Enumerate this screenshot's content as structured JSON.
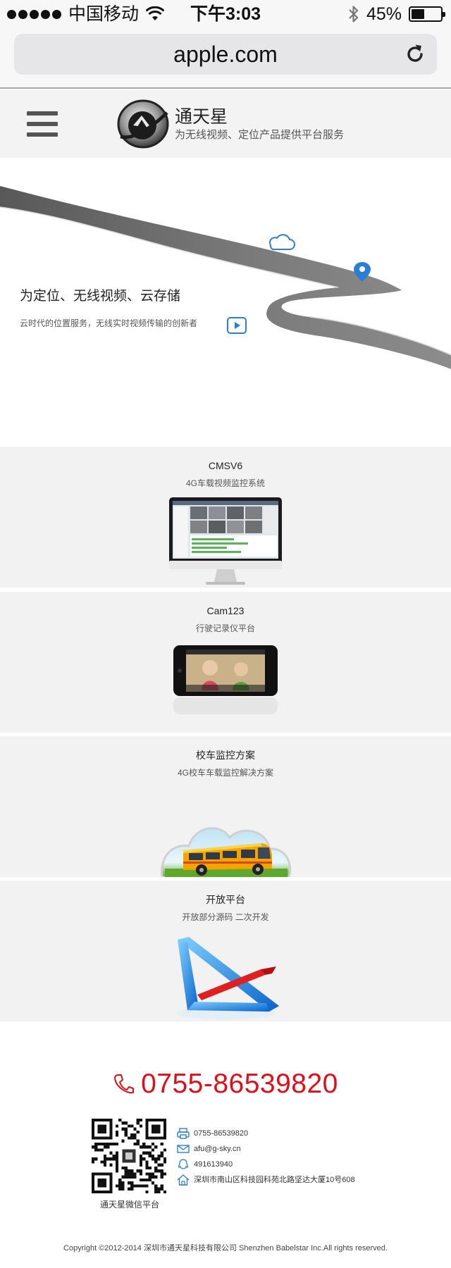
{
  "status_bar": {
    "carrier": "中国移动",
    "time": "下午3:03",
    "battery_percent_label": "45%",
    "battery_level": 0.45
  },
  "browser": {
    "url": "apple.com"
  },
  "header": {
    "brand_name": "通天星",
    "slogan": "为无线视频、定位产品提供平台服务"
  },
  "hero": {
    "title": "为定位、无线视频、云存储",
    "subtitle": "云时代的位置服务，无线实时视频传输的创新者"
  },
  "products": [
    {
      "title": "CMSV6",
      "subtitle": "4G车载视频监控系统"
    },
    {
      "title": "Cam123",
      "subtitle": "行驶记录仪平台"
    },
    {
      "title": "校车监控方案",
      "subtitle": "4G校车车载监控解决方案"
    },
    {
      "title": "开放平台",
      "subtitle": "开放部分源码  二次开发"
    }
  ],
  "footer": {
    "phone": "0755-86539820",
    "qr_caption": "通天星微信平台",
    "contacts": [
      {
        "icon": "fax-icon",
        "text": "0755-86539820"
      },
      {
        "icon": "email-icon",
        "text": "afu@g-sky.cn"
      },
      {
        "icon": "qq-icon",
        "text": "491613940"
      },
      {
        "icon": "home-icon",
        "text": "深圳市南山区科技园科苑北路坚达大厦10号608"
      }
    ],
    "copyright": "Copyright ©2012-2014 深圳市通天星科技有限公司  Shenzhen Babelstar Inc.All rights reserved."
  },
  "colors": {
    "accent_red": "#e10e1a",
    "accent_blue": "#2a7fd4",
    "road_gray": "#6e6e6e",
    "card_bg": "#f2f2f2"
  }
}
